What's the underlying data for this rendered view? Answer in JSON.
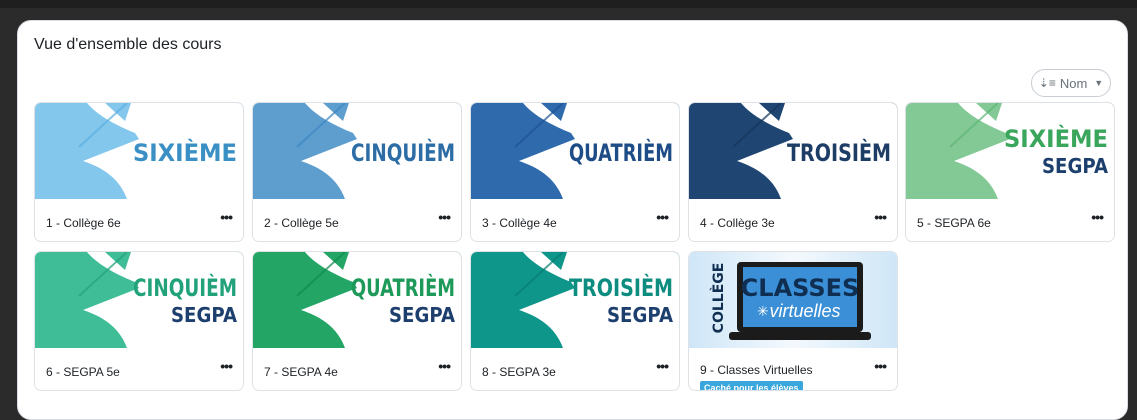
{
  "overview": {
    "title": "Vue d'ensemble des cours",
    "sort_label": "Nom"
  },
  "colors": {
    "page_bg": "#2b2b2b",
    "card_border": "#dee2e6",
    "badge_bg": "#39a7db"
  },
  "courses": [
    {
      "name": "1 - Collège 6e",
      "banner_line1": "SIXIÈME",
      "banner_line2": "",
      "bg": "#84c7ec",
      "shape": "#5aaee0",
      "text_color": "#3a8fc4"
    },
    {
      "name": "2 - Collège 5e",
      "banner_line1": "CINQUIÈM",
      "banner_line2": "",
      "bg": "#5d9ecf",
      "shape": "#3d86c0",
      "text_color": "#2d6da6"
    },
    {
      "name": "3 - Collège 4e",
      "banner_line1": "QUATRIÈM",
      "banner_line2": "",
      "bg": "#2f6aad",
      "shape": "#1d5395",
      "text_color": "#1d4c86"
    },
    {
      "name": "4 - Collège 3e",
      "banner_line1": "TROISIÈM",
      "banner_line2": "",
      "bg": "#1f4672",
      "shape": "#16355a",
      "text_color": "#1d3d66"
    },
    {
      "name": "5 - SEGPA 6e",
      "banner_line1": "SIXIÈME",
      "banner_line2": "SEGPA",
      "bg": "#82c995",
      "shape": "#5fb577",
      "text_color": "#3aa65c"
    },
    {
      "name": "6 - SEGPA 5e",
      "banner_line1": "CINQUIÈM",
      "banner_line2": "SEGPA",
      "bg": "#3fbd96",
      "shape": "#22a37b",
      "text_color": "#21a27a"
    },
    {
      "name": "7 - SEGPA 4e",
      "banner_line1": "QUATRIÈM",
      "banner_line2": "SEGPA",
      "bg": "#23a565",
      "shape": "#128a4f",
      "text_color": "#1d9a5a"
    },
    {
      "name": "8 - SEGPA 3e",
      "banner_line1": "TROISIÈM",
      "banner_line2": "SEGPA",
      "bg": "#0e968a",
      "shape": "#067d72",
      "text_color": "#0d8c80"
    },
    {
      "name": "9 - Classes Virtuelles",
      "banner_line1": "CLASSES",
      "banner_line2": "virtuelles",
      "side_text": "COLLÈGE",
      "badge": "Caché pour les élèves"
    }
  ]
}
